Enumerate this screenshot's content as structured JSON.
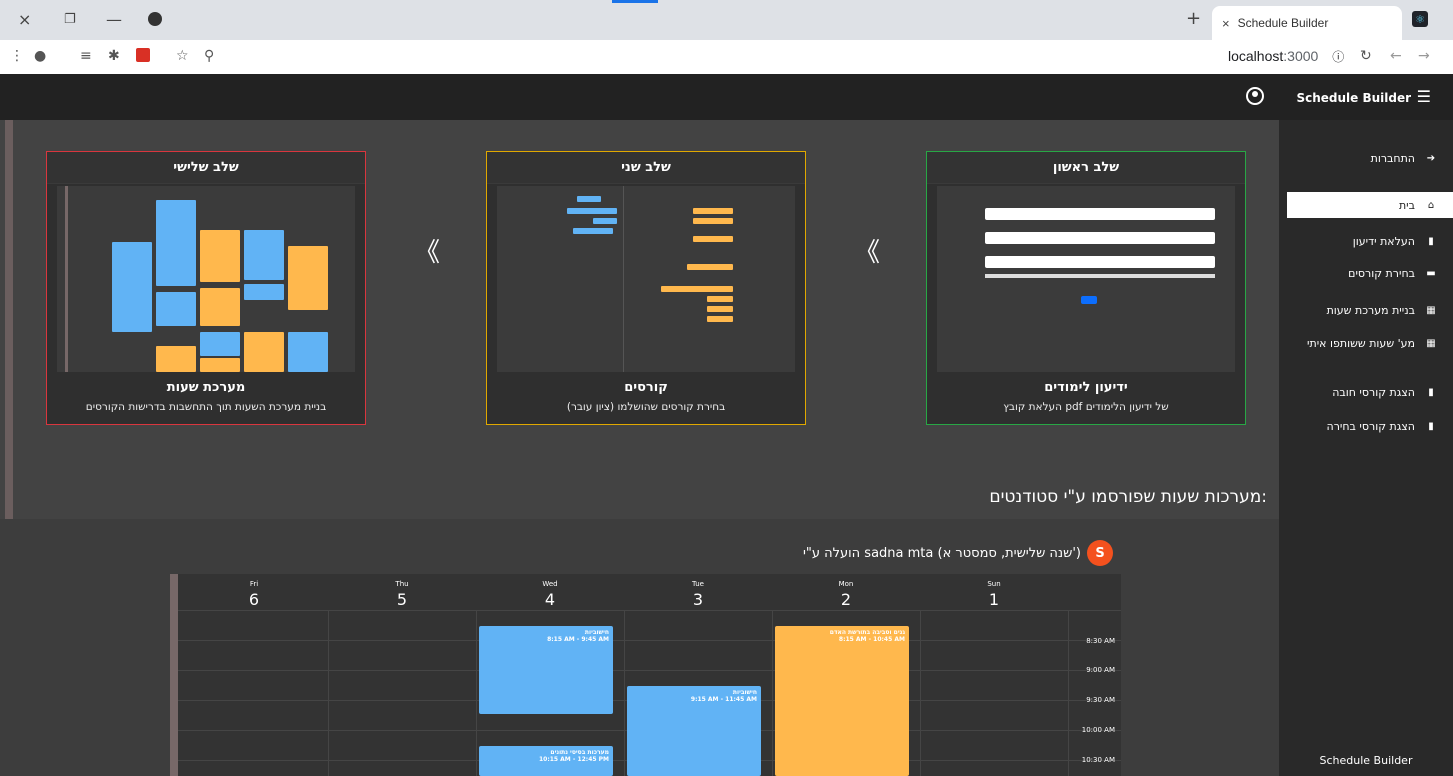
{
  "browser": {
    "tab_title": "Schedule Builder",
    "tab_close": "×",
    "new_tab": "+",
    "address": "localhost",
    "port": ":3000",
    "window_controls": {
      "close": "×",
      "restore": "❐",
      "minimize": "—"
    }
  },
  "navbar": {
    "brand": "Schedule Builder",
    "menu_icon": "☰"
  },
  "sidebar": {
    "items": [
      {
        "label": "התחברות",
        "icon": "sign-in-icon"
      },
      {
        "label": "בית",
        "icon": "home-icon",
        "active": true
      },
      {
        "label": "העלאת ידיעון",
        "icon": "file-upload-icon"
      },
      {
        "label": "בחירת קורסים",
        "icon": "list-icon"
      },
      {
        "label": "בניית מערכת שעות",
        "icon": "calendar-icon"
      },
      {
        "label": "מע' שעות ששותפו איתי",
        "icon": "calendar-icon"
      },
      {
        "label": "הצגת קורסי חובה",
        "icon": "bookmark-icon"
      },
      {
        "label": "הצגת קורסי בחירה",
        "icon": "bookmark-icon"
      }
    ],
    "footer": "Schedule Builder"
  },
  "steps": [
    {
      "header": "שלב שלישי",
      "title": "מערכת שעות",
      "desc": "בניית מערכת השעות תוך התחשבות בדרישות הקורסים",
      "border": "#d9363e"
    },
    {
      "header": "שלב שני",
      "title": "קורסים",
      "desc": "בחירת קורסים שהושלמו (ציון עובר)",
      "border": "#e0a800"
    },
    {
      "header": "שלב ראשון",
      "title": "ידיעון לימודים",
      "desc": "העלאת קובץ pdf של ידיעון הלימודים",
      "border": "#28a745"
    }
  ],
  "step_arrow": "《",
  "published": {
    "title": "מערכות שעות שפורסמו ע\"י סטודנטים:",
    "uploader_text": "הועלה ע\"י sadna mta (שנה שלישית, סמסטר א')",
    "avatar_letter": "S"
  },
  "calendar": {
    "days": [
      {
        "name": "Fri",
        "num": "6"
      },
      {
        "name": "Thu",
        "num": "5"
      },
      {
        "name": "Wed",
        "num": "4"
      },
      {
        "name": "Tue",
        "num": "3"
      },
      {
        "name": "Mon",
        "num": "2"
      },
      {
        "name": "Sun",
        "num": "1"
      }
    ],
    "times": [
      "8:30 AM",
      "9:00 AM",
      "9:30 AM",
      "10:00 AM",
      "10:30 AM"
    ],
    "events": [
      {
        "title": "חישוביות",
        "time": "8:15 AM  -  9:45 AM",
        "day": "Wed",
        "color": "#61b3f5"
      },
      {
        "title": "חישוביות",
        "time": "9:15 AM  -  11:45 AM",
        "day": "Tue",
        "color": "#61b3f5"
      },
      {
        "title": "מערכות בסיסי נתונים",
        "time": "10:15 AM  -  12:45 PM",
        "day": "Wed",
        "color": "#61b3f5"
      },
      {
        "title": "גנים וסביבה בתורשת האדם",
        "time": "8:15 AM  -  10:45 AM",
        "day": "Mon",
        "color": "#ffb84d"
      }
    ]
  }
}
